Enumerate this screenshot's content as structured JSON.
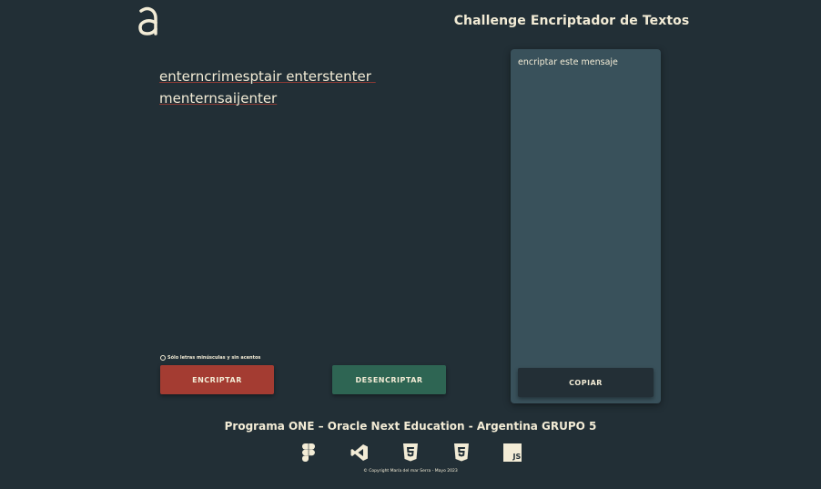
{
  "header": {
    "title": "Challenge Encriptador de Textos",
    "logo_icon": "alura-a-logo-icon"
  },
  "input": {
    "value": "enterncrimesptair enterstenter menternsaijenter",
    "hint": "Sólo letras minúsculas y sin acentos"
  },
  "buttons": {
    "encrypt_label": "ENCRIPTAR",
    "decrypt_label": "DESENCRIPTAR",
    "copy_label": "COPIAR"
  },
  "output": {
    "text": "encriptar este mensaje"
  },
  "footer": {
    "title": "Programa ONE – Oracle Next Education - Argentina GRUPO 5",
    "tech_icons": [
      "figma-icon",
      "vscode-icon",
      "html5-icon",
      "css3-icon",
      "javascript-icon"
    ],
    "copyright": "© Copyright María del mar Serra - Mayo 2023"
  },
  "colors": {
    "background": "#222f36",
    "text": "#f3ecd6",
    "encrypt": "#a43c32",
    "decrypt": "#2e6553",
    "panel": "#39515b"
  }
}
